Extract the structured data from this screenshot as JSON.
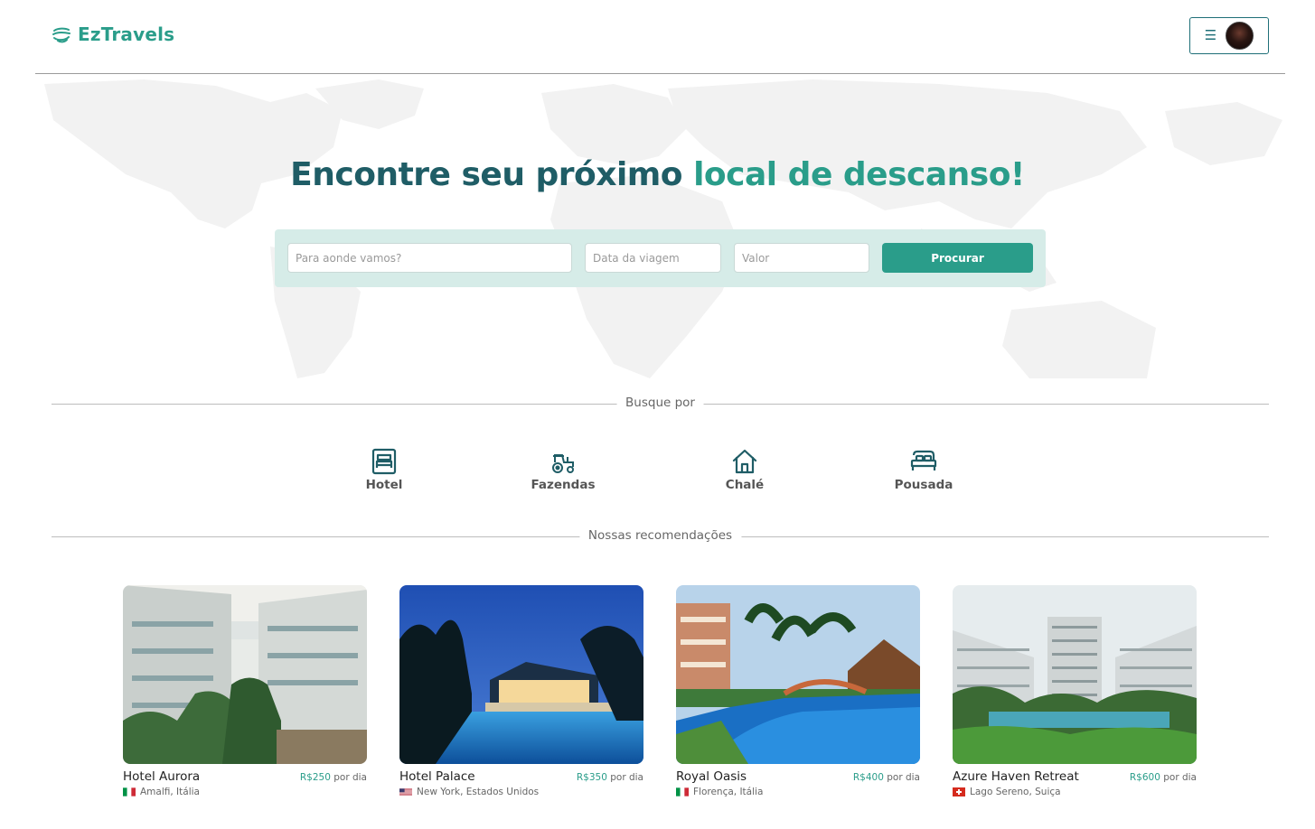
{
  "brand": {
    "name": "EzTravels"
  },
  "header": {
    "menu_icon": "hamburger-icon"
  },
  "hero": {
    "title_part1": "Encontre seu próximo",
    "title_part2": "local de descanso!"
  },
  "search": {
    "destination_placeholder": "Para aonde vamos?",
    "date_placeholder": "Data da viagem",
    "value_placeholder": "Valor",
    "button_label": "Procurar"
  },
  "sections": {
    "browse_title": "Busque por",
    "recommendations_title": "Nossas recomendações"
  },
  "categories": [
    {
      "label": "Hotel",
      "icon": "hotel-icon"
    },
    {
      "label": "Fazendas",
      "icon": "tractor-icon"
    },
    {
      "label": "Chalé",
      "icon": "house-icon"
    },
    {
      "label": "Pousada",
      "icon": "bed-icon"
    }
  ],
  "recommendations": [
    {
      "name": "Hotel Aurora",
      "price": "R$250",
      "per": "por dia",
      "location": "Amalfi, Itália",
      "flag": "italy-flag"
    },
    {
      "name": "Hotel Palace",
      "price": "R$350",
      "per": "por dia",
      "location": "New York, Estados Unidos",
      "flag": "usa-flag"
    },
    {
      "name": "Royal Oasis",
      "price": "R$400",
      "per": "por dia",
      "location": "Florença, Itália",
      "flag": "italy-flag"
    },
    {
      "name": "Azure Haven Retreat",
      "price": "R$600",
      "per": "por dia",
      "location": "Lago Sereno, Suiça",
      "flag": "switzerland-flag"
    }
  ],
  "colors": {
    "brand": "#2a9d8a",
    "dark_teal": "#1f5d66",
    "search_bg": "#d6ece8"
  }
}
